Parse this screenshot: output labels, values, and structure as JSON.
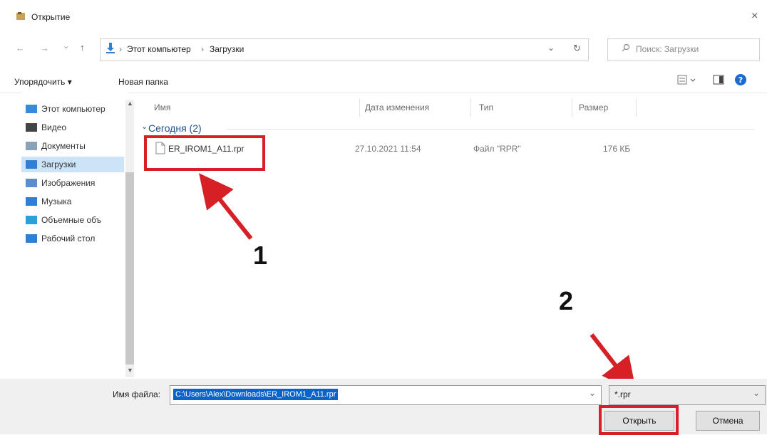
{
  "window": {
    "title": "Открытие",
    "close_glyph": "×"
  },
  "navigation": {
    "back_glyph": "←",
    "forward_glyph": "→",
    "recent_glyph": "⌄",
    "up_glyph": "↑",
    "breadcrumb": [
      "Этот компьютер",
      "Загрузки"
    ],
    "separator": "›",
    "dropdown_glyph": "⌄",
    "refresh_glyph": "↻",
    "search_placeholder": "Поиск: Загрузки"
  },
  "toolbar": {
    "organize_label": "Упорядочить ▾",
    "new_folder_label": "Новая папка"
  },
  "sidebar": {
    "items": [
      {
        "label": "Этот компьютер",
        "icon": "computer-icon",
        "color": "#3b8ad9"
      },
      {
        "label": "Видео",
        "icon": "video-icon",
        "color": "#444444"
      },
      {
        "label": "Документы",
        "icon": "documents-icon",
        "color": "#8aa2b8"
      },
      {
        "label": "Загрузки",
        "icon": "downloads-icon",
        "color": "#2f7fd6",
        "selected": true
      },
      {
        "label": "Изображения",
        "icon": "pictures-icon",
        "color": "#5b8fc9"
      },
      {
        "label": "Музыка",
        "icon": "music-icon",
        "color": "#2f7fd6"
      },
      {
        "label": "Объемные объ",
        "icon": "3d-objects-icon",
        "color": "#2a9fd8"
      },
      {
        "label": "Рабочий стол",
        "icon": "desktop-icon",
        "color": "#2f7fd6"
      }
    ]
  },
  "file_list": {
    "columns": [
      "Имя",
      "Дата изменения",
      "Тип",
      "Размер"
    ],
    "group": "Сегодня (2)",
    "files": [
      {
        "name": "ER_IROM1_A11.rpr",
        "modified": "27.10.2021 11:54",
        "type": "Файл \"RPR\"",
        "size": "176 КБ"
      }
    ]
  },
  "bottom": {
    "filename_label": "Имя файла:",
    "filename_value": "C:\\Users\\Alex\\Downloads\\ER_IROM1_A11.rpr",
    "filter_value": "*.rpr",
    "open_button": "Открыть",
    "cancel_button": "Отмена"
  },
  "annotations": {
    "step1": "1",
    "step2": "2",
    "color": "#d71f26"
  }
}
